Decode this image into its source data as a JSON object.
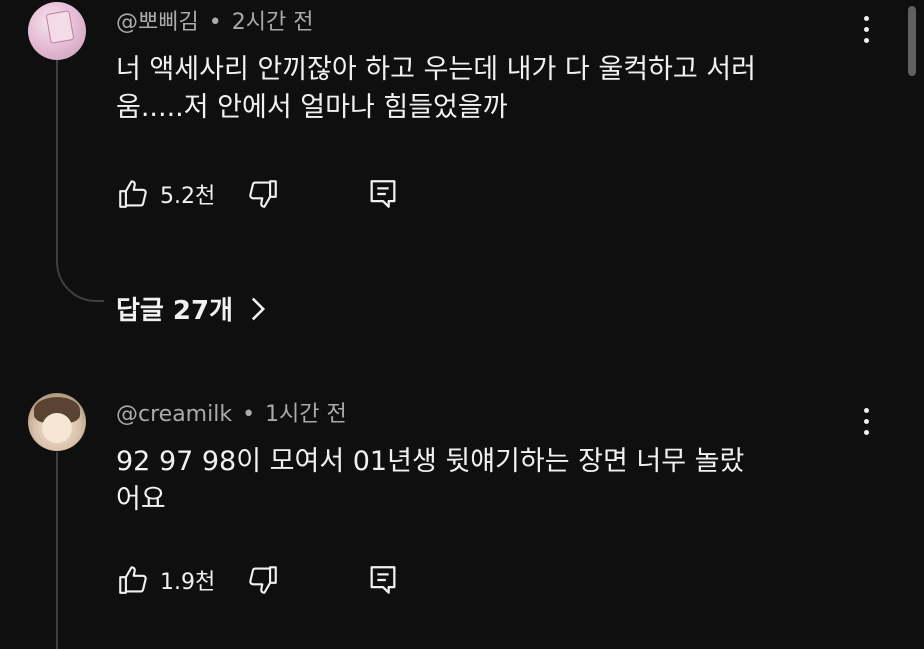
{
  "comments": [
    {
      "author": "@뽀삐김",
      "time": "2시간 전",
      "text_line1": "너 액세사리 안끼잖아 하고 우는데 내가 다 울컥하고 서러",
      "text_line2": "움.....저 안에서 얼마나 힘들었을까",
      "likes": "5.2천",
      "replies_label": "답글 27개"
    },
    {
      "author": "@creamilk",
      "time": "1시간 전",
      "text_line1": "92 97 98이 모여서 01년생 뒷얘기하는 장면 너무 놀랐",
      "text_line2": "어요",
      "likes": "1.9천"
    }
  ],
  "separator": "•",
  "icons": {
    "like": "thumbs-up-icon",
    "dislike": "thumbs-down-icon",
    "reply": "reply-comment-icon",
    "more": "more-vertical-icon",
    "expand": "chevron-right-icon"
  },
  "colors": {
    "background": "#0f0f0f",
    "text": "#f1f1f1",
    "meta": "#aaaaaa",
    "thread": "#3f3f3f"
  }
}
